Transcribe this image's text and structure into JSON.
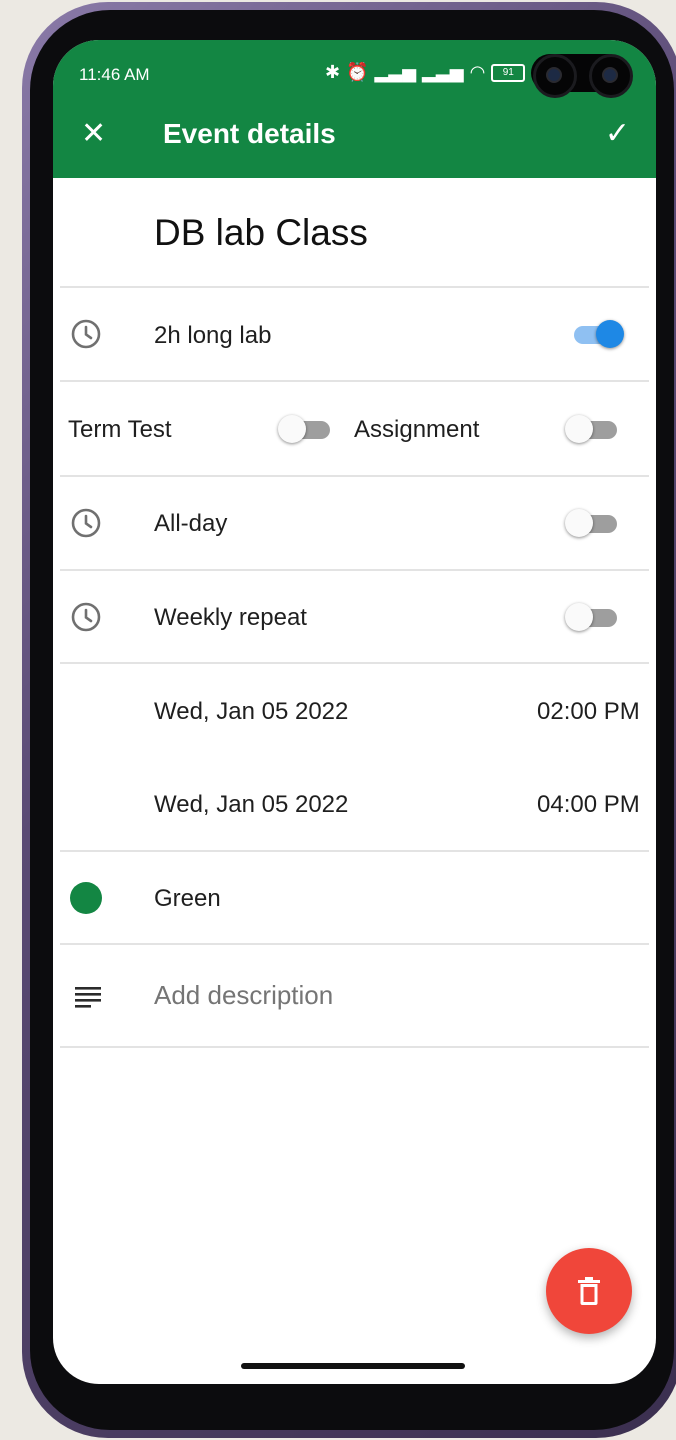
{
  "status": {
    "time": "11:46 AM",
    "battery": "91"
  },
  "appbar": {
    "title": "Event details",
    "close_icon": "close-icon",
    "save_icon": "check-icon",
    "color": "#138643"
  },
  "event": {
    "title": "DB lab Class"
  },
  "rows": {
    "lab": {
      "label": "2h long lab",
      "on": true
    },
    "term_test": {
      "label": "Term Test",
      "on": false
    },
    "assignment": {
      "label": "Assignment",
      "on": false
    },
    "all_day": {
      "label": "All-day",
      "on": false
    },
    "weekly_repeat": {
      "label": "Weekly repeat",
      "on": false
    }
  },
  "start": {
    "date": "Wed, Jan 05 2022",
    "time": "02:00 PM"
  },
  "end": {
    "date": "Wed, Jan 05 2022",
    "time": "04:00 PM"
  },
  "color": {
    "label": "Green",
    "value": "#138643"
  },
  "description": {
    "placeholder": "Add description"
  },
  "fab": {
    "icon": "delete-icon",
    "color": "#f0463a"
  }
}
